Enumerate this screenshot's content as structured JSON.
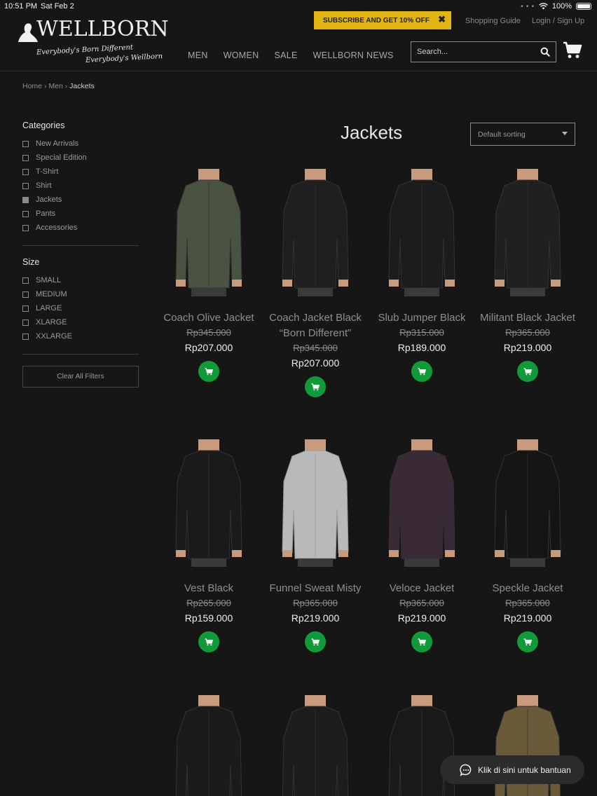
{
  "status_bar": {
    "time": "10:51 PM",
    "date": "Sat Feb 2",
    "battery": "100%"
  },
  "header": {
    "logo_text": "WELLBORN",
    "logo_tagline_1": "Everybody's Born Different",
    "logo_tagline_2": "Everybody's Wellborn",
    "promo_text": "SUBSCRIBE AND GET 10% OFF",
    "promo_close": "✖",
    "top_links": [
      "Shopping Guide",
      "Login / Sign Up"
    ],
    "nav": [
      "MEN",
      "WOMEN",
      "SALE",
      "WELLBORN NEWS"
    ],
    "search_placeholder": "Search..."
  },
  "breadcrumb": {
    "home": "Home",
    "sep": "›",
    "parent": "Men",
    "current": "Jackets"
  },
  "sidebar": {
    "categories_title": "Categories",
    "categories": [
      {
        "label": "New Arrivals",
        "checked": false
      },
      {
        "label": "Special Edition",
        "checked": false
      },
      {
        "label": "T-Shirt",
        "checked": false
      },
      {
        "label": "Shirt",
        "checked": false
      },
      {
        "label": "Jackets",
        "checked": true
      },
      {
        "label": "Pants",
        "checked": false
      },
      {
        "label": "Accessories",
        "checked": false
      }
    ],
    "size_title": "Size",
    "sizes": [
      "SMALL",
      "MEDIUM",
      "LARGE",
      "XLARGE",
      "XXLARGE"
    ],
    "clear_label": "Clear All Filters"
  },
  "main": {
    "title": "Jackets",
    "sorting": "Default sorting",
    "products": [
      {
        "name": "Coach Olive Jacket",
        "old_price": "Rp345.000",
        "price": "Rp207.000",
        "color": "#4a5242"
      },
      {
        "name": "Coach Jacket Black “Born Different”",
        "old_price": "Rp345.000",
        "price": "Rp207.000",
        "color": "#1f1f1f"
      },
      {
        "name": "Slub Jumper Black",
        "old_price": "Rp315.000",
        "price": "Rp189.000",
        "color": "#1c1c1c"
      },
      {
        "name": "Militant Black Jacket",
        "old_price": "Rp365.000",
        "price": "Rp219.000",
        "color": "#202020"
      },
      {
        "name": "Vest Black",
        "old_price": "Rp265.000",
        "price": "Rp159.000",
        "color": "#1a1a1a"
      },
      {
        "name": "Funnel Sweat Misty",
        "old_price": "Rp365.000",
        "price": "Rp219.000",
        "color": "#b9b9b9"
      },
      {
        "name": "Veloce Jacket",
        "old_price": "Rp365.000",
        "price": "Rp219.000",
        "color": "#3a2a36"
      },
      {
        "name": "Speckle Jacket",
        "old_price": "Rp365.000",
        "price": "Rp219.000",
        "color": "#151515"
      }
    ],
    "partial_row_colors": [
      "#1b1b1b",
      "#1d1d1d",
      "#1a1a1a",
      "#6b5a3a"
    ]
  },
  "chat": {
    "label": "Klik di sini untuk bantuan"
  },
  "colors": {
    "background": "#161616",
    "promo": "#e0b413",
    "add_to_cart": "#119a3a"
  }
}
